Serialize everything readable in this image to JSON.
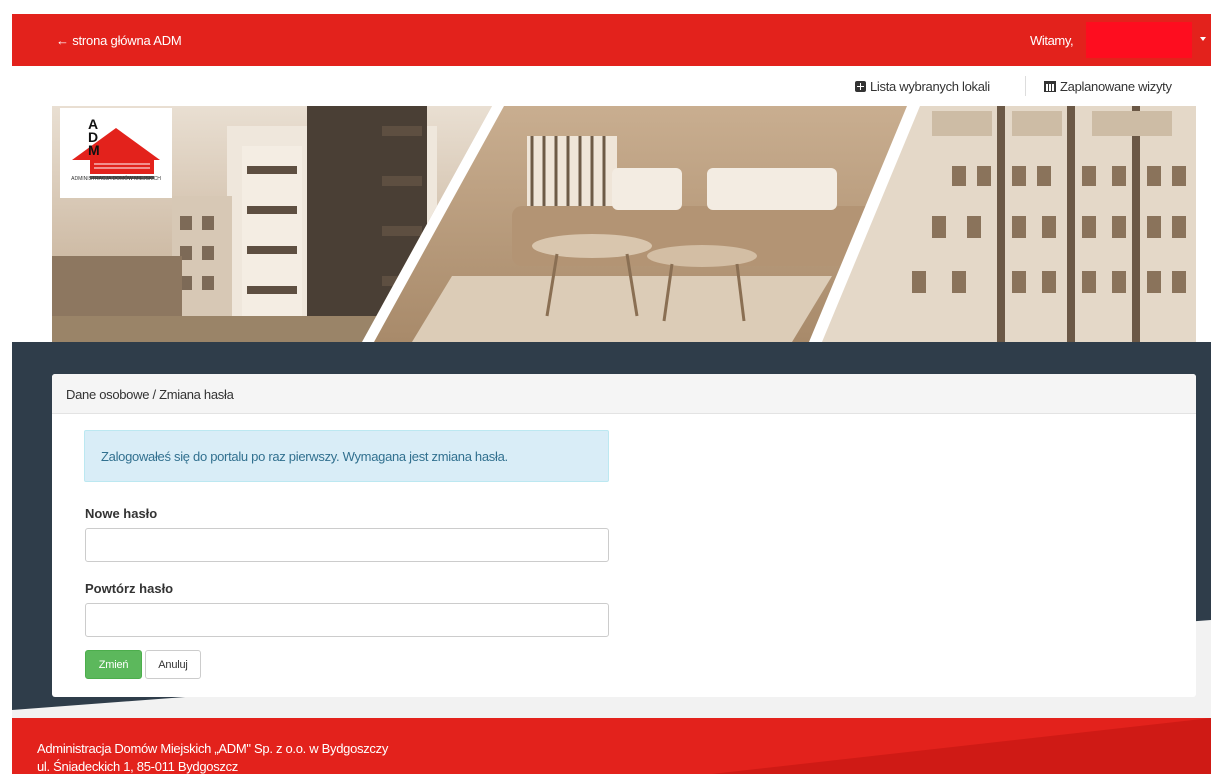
{
  "header": {
    "home_link": "← strona główna ADM",
    "welcome": "Witamy,"
  },
  "subnav": {
    "selected_units": "Lista wybranych lokali",
    "planned_visits": "Zaplanowane wizyty"
  },
  "logo": {
    "letters": "A\nD\nM",
    "subtitle": "ADMINISTRACJA DOMÓW MIEJSKICH"
  },
  "panel": {
    "breadcrumb": "Dane osobowe / Zmiana hasła",
    "alert": "Zalogowałeś się do portalu po raz pierwszy. Wymagana jest zmiana hasła.",
    "new_password_label": "Nowe hasło",
    "new_password_value": "",
    "repeat_password_label": "Powtórz hasło",
    "repeat_password_value": "",
    "save_button": "Zmień",
    "cancel_button": "Anuluj"
  },
  "footer": {
    "line1": "Administracja Domów Miejskich „ADM\" Sp. z o.o. w Bydgoszczy",
    "line2": "ul. Śniadeckich 1, 85-011 Bydgoszcz"
  },
  "colors": {
    "brand_red": "#e3221c",
    "dark_band": "#2f3d4a",
    "success_green": "#5cb85c",
    "alert_bg": "#d9edf7",
    "alert_text": "#31708f"
  }
}
